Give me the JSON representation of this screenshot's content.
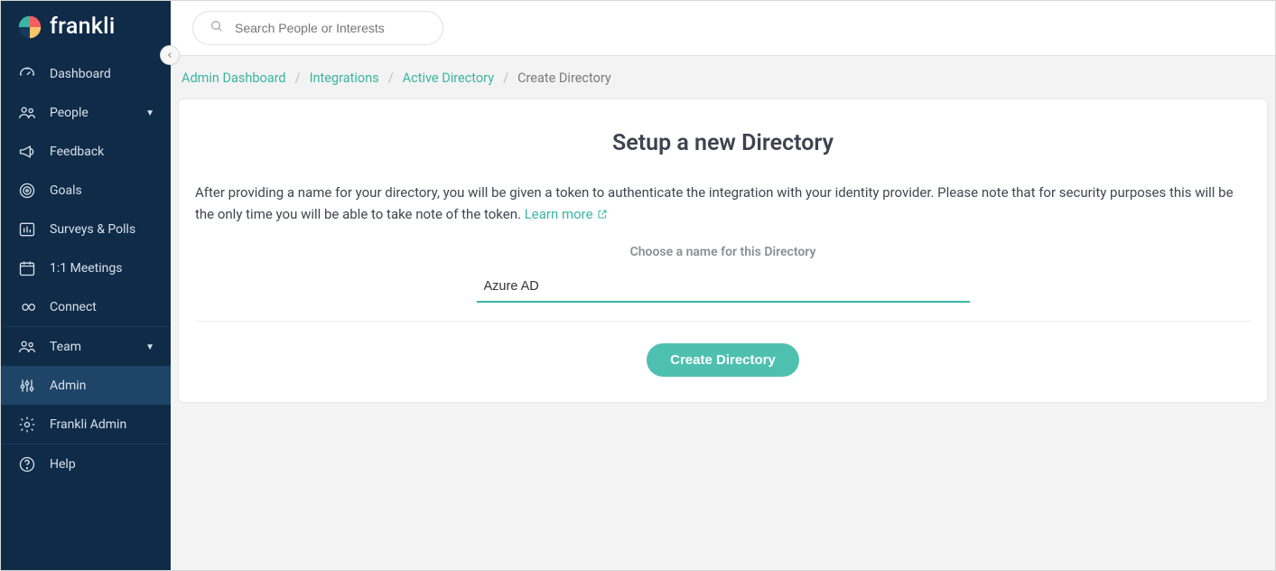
{
  "brand": {
    "name": "frankli"
  },
  "search": {
    "placeholder": "Search People or Interests"
  },
  "sidebar": {
    "items": [
      {
        "label": "Dashboard",
        "expandable": false
      },
      {
        "label": "People",
        "expandable": true
      },
      {
        "label": "Feedback",
        "expandable": false
      },
      {
        "label": "Goals",
        "expandable": false
      },
      {
        "label": "Surveys & Polls",
        "expandable": false
      },
      {
        "label": "1:1 Meetings",
        "expandable": false
      },
      {
        "label": "Connect",
        "expandable": false
      },
      {
        "label": "Team",
        "expandable": true
      },
      {
        "label": "Admin",
        "expandable": false
      },
      {
        "label": "Frankli Admin",
        "expandable": false
      },
      {
        "label": "Help",
        "expandable": false
      }
    ]
  },
  "breadcrumbs": {
    "items": [
      "Admin Dashboard",
      "Integrations",
      "Active Directory",
      "Create Directory"
    ]
  },
  "page": {
    "title": "Setup a new Directory",
    "description": "After providing a name for your directory, you will be given a token to authenticate the integration with your identity provider. Please note that for security purposes this will be the only time you will be able to take note of the token.",
    "learn_more": "Learn more",
    "field_label": "Choose a name for this Directory",
    "field_value": "Azure AD",
    "submit_label": "Create Directory"
  }
}
